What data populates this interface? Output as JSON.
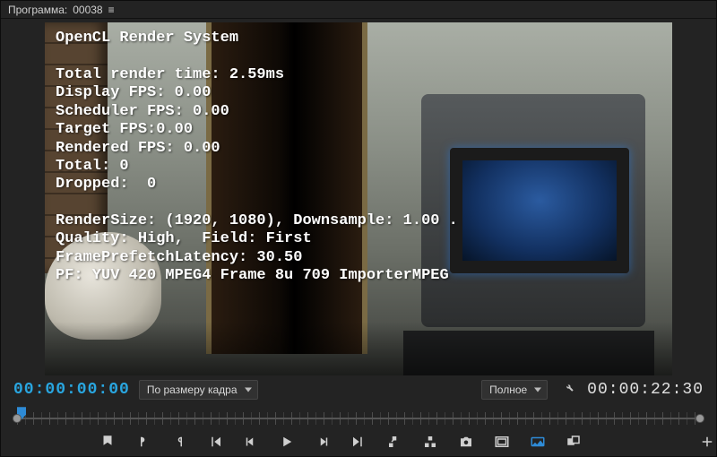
{
  "title": {
    "label": "Программа:",
    "clip": "00038"
  },
  "overlay": {
    "header": "OpenCL Render System",
    "total_render_time_label": "Total render time:",
    "total_render_time_value": "2.59ms",
    "display_fps": "0.00",
    "scheduler_fps": "0.00",
    "target_fps": "0.00",
    "rendered_fps": "0.00",
    "total_frames": "0",
    "dropped_frames": "0",
    "render_size": "(1920, 1080)",
    "downsample": "1.00",
    "quality": "High",
    "field": "First",
    "frame_prefetch_latency": "30.50",
    "pixel_format": "YUV 420 MPEG4 Frame 8u 709 ImporterMPEG"
  },
  "timecode": {
    "current": "00:00:00:00",
    "duration": "00:00:22:30"
  },
  "zoom_dropdown": {
    "selected": "По размеру кадра"
  },
  "quality_dropdown": {
    "selected": "Полное"
  },
  "transport": {
    "mark_in": "Mark In",
    "mark_out": "Mark Out",
    "goto_in": "Go to In",
    "goto_out": "Go to Out",
    "step_back": "Step Back",
    "play": "Play",
    "step_fwd": "Step Forward",
    "lift": "Lift",
    "extract": "Extract",
    "export_frame": "Export Frame",
    "safe_margins": "Safe Margins",
    "comparison": "Comparison View",
    "add": "Add"
  },
  "icons": {
    "menu": "≡",
    "wrench": "wrench-icon"
  }
}
